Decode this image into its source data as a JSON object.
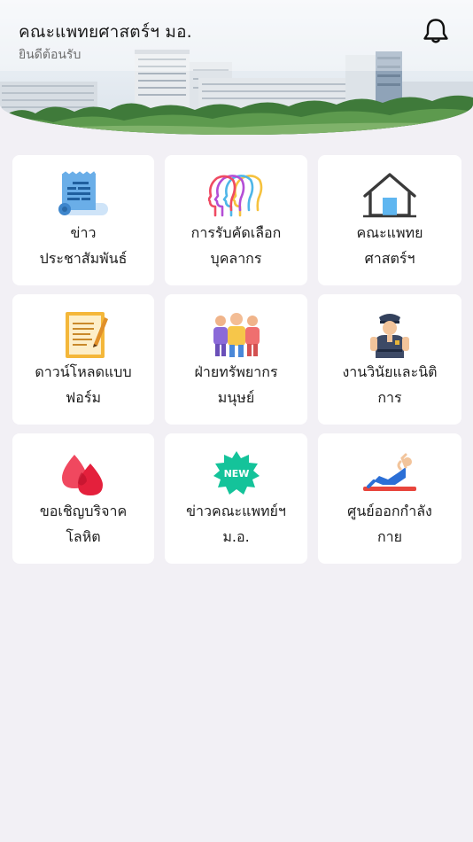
{
  "header": {
    "title": "คณะแพทยศาสตร์ฯ มอ.",
    "subtitle": "ยินดีต้อนรับ",
    "notification_icon": "bell-icon"
  },
  "menu": {
    "tiles": [
      {
        "icon": "news-scroll-icon",
        "line1": "ข่าว",
        "line2": "ประชาสัมพันธ์"
      },
      {
        "icon": "recruitment-heads-icon",
        "line1": "การรับคัดเลือก",
        "line2": "บุคลากร"
      },
      {
        "icon": "home-icon",
        "line1": "คณะแพทย",
        "line2": "ศาสตร์ฯ"
      },
      {
        "icon": "form-document-icon",
        "line1": "ดาวน์โหลดแบบ",
        "line2": "ฟอร์ม"
      },
      {
        "icon": "people-group-icon",
        "line1": "ฝ่ายทรัพยากร",
        "line2": "มนุษย์"
      },
      {
        "icon": "police-officer-icon",
        "line1": "งานวินัยและนิติ",
        "line2": "การ"
      },
      {
        "icon": "blood-drop-icon",
        "line1": "ขอเชิญบริจาค",
        "line2": "โลหิต"
      },
      {
        "icon": "new-badge-icon",
        "line1": "ข่าวคณะแพทย์ฯ",
        "line2": "ม.อ.",
        "badge_text": "NEW"
      },
      {
        "icon": "exercise-icon",
        "line1": "ศูนย์ออกกำลัง",
        "line2": "กาย"
      }
    ]
  },
  "colors": {
    "background": "#f2f0f5",
    "tile": "#ffffff",
    "new_badge": "#14c39a"
  }
}
